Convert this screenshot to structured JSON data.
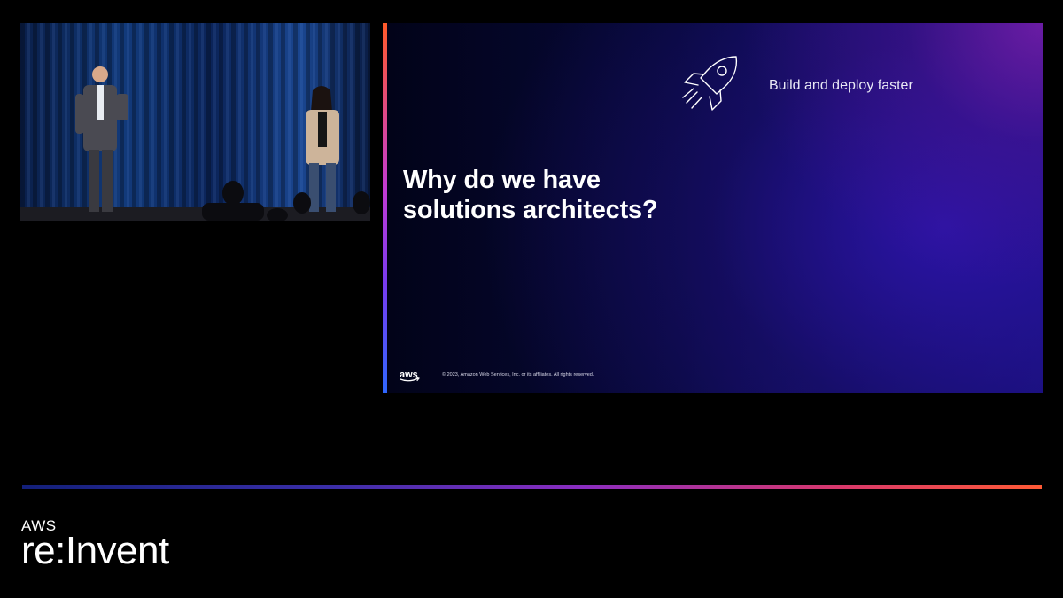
{
  "slide": {
    "title_line1": "Why do we have",
    "title_line2": "solutions architects?",
    "tagline": "Build and deploy faster",
    "tagline_icon": "rocket-icon",
    "logo_text": "aws",
    "copyright": "© 2023, Amazon Web Services, Inc. or its affiliates. All rights reserved."
  },
  "brand": {
    "prefix": "AWS",
    "name": "re:Invent"
  },
  "colors": {
    "background": "#000000",
    "accent_orange": "#ff5a2a",
    "accent_purple": "#8a2dc0",
    "accent_blue": "#2f67ff",
    "slide_deep": "#1a128a"
  }
}
